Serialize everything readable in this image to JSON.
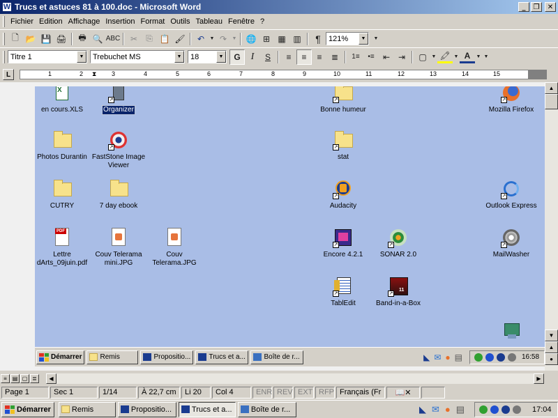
{
  "window": {
    "title": "Trucs et astuces 81 à 100.doc - Microsoft Word",
    "app_icon": "W"
  },
  "menu": [
    "Fichier",
    "Edition",
    "Affichage",
    "Insertion",
    "Format",
    "Outils",
    "Tableau",
    "Fenêtre",
    "?"
  ],
  "standard_toolbar": {
    "zoom": "121%"
  },
  "format_toolbar": {
    "style": "Titre 1",
    "font": "Trebuchet MS",
    "size": "18"
  },
  "ruler": {
    "numbers": [
      "1",
      "1",
      "2",
      "3",
      "4",
      "5",
      "6",
      "7",
      "8",
      "9",
      "10",
      "11",
      "12",
      "13",
      "14",
      "15"
    ]
  },
  "desktop_icons": [
    {
      "label": "en cours.XLS",
      "icon": "excel-file-icon"
    },
    {
      "label": "Organizer",
      "icon": "organizer-icon",
      "selected": true
    },
    {
      "label": "Bonne humeur",
      "icon": "folder-icon"
    },
    {
      "label": "Mozilla Firefox",
      "icon": "firefox-icon"
    },
    {
      "label": "Photos Durantin",
      "icon": "folder-icon"
    },
    {
      "label": "FastStone Image Viewer",
      "icon": "faststone-icon"
    },
    {
      "label": "stat",
      "icon": "folder-icon"
    },
    {
      "label": "CUTRY",
      "icon": "folder-icon"
    },
    {
      "label": "7 day ebook",
      "icon": "folder-icon"
    },
    {
      "label": "Audacity",
      "icon": "audacity-icon"
    },
    {
      "label": "Outlook Express",
      "icon": "outlook-express-icon"
    },
    {
      "label": "Lettre dArts_09juin.pdf",
      "icon": "pdf-file-icon"
    },
    {
      "label": "Couv Telerama mini.JPG",
      "icon": "jpg-file-icon"
    },
    {
      "label": "Couv Telerama.JPG",
      "icon": "jpg-file-icon"
    },
    {
      "label": "Encore 4.2.1",
      "icon": "encore-icon"
    },
    {
      "label": "SONAR 2.0",
      "icon": "sonar-icon"
    },
    {
      "label": "MailWasher",
      "icon": "mailwasher-icon"
    },
    {
      "label": "TablEdit",
      "icon": "tabledit-icon"
    },
    {
      "label": "Band-in-a-Box",
      "icon": "band-in-a-box-icon"
    }
  ],
  "inner_taskbar": {
    "start_label": "Démarrer",
    "buttons": [
      "Remis",
      "Propositio...",
      "Trucs et a...",
      "Boîte de r..."
    ],
    "clock": "16:58"
  },
  "statusbar": {
    "page": "Page  1",
    "section": "Sec  1",
    "pages": "1/14",
    "position": "À  22,7 cm",
    "line": "Li  20",
    "column": "Col  4",
    "modes": [
      "ENR",
      "REV",
      "EXT",
      "RFP"
    ],
    "language": "Français (Fr"
  },
  "taskbar": {
    "start_label": "Démarrer",
    "buttons": [
      "Remis",
      "Propositio...",
      "Trucs et a...",
      "Boîte de r..."
    ],
    "clock": "17:04"
  }
}
